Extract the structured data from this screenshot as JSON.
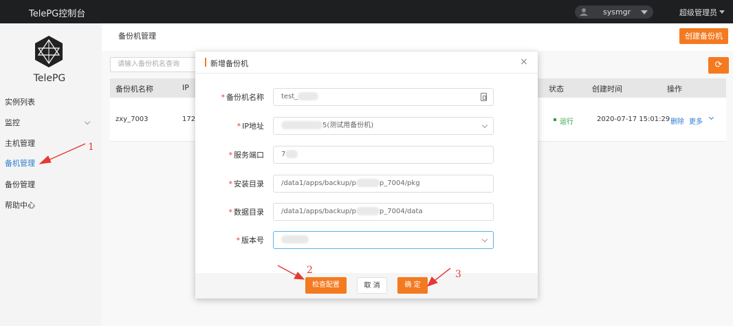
{
  "app": {
    "title": "TelePG控制台",
    "brand": "TelePG"
  },
  "topbar": {
    "username": "sysmgr",
    "role": "超级管理员"
  },
  "sidebar": {
    "items": [
      {
        "label": "实例列表"
      },
      {
        "label": "监控"
      },
      {
        "label": "主机管理"
      },
      {
        "label": "备机管理"
      },
      {
        "label": "备份管理"
      },
      {
        "label": "帮助中心"
      }
    ],
    "active": "备机管理"
  },
  "page": {
    "title": "备份机管理",
    "create_button": "创建备份机",
    "search_placeholder": "请输入备份机名查询",
    "refresh_icon": "refresh-icon"
  },
  "table": {
    "headers": [
      "备份机名称",
      "IP",
      "状态",
      "创建时间",
      "操作"
    ],
    "rows": [
      {
        "name": "zxy_7003",
        "ip": "172.",
        "status": "运行",
        "created": "2020-07-17 15:01:29",
        "delete": "删除",
        "more": "更多"
      }
    ]
  },
  "modal": {
    "title": "新增备份机",
    "fields": [
      {
        "label": "备份机名称",
        "value": "test_"
      },
      {
        "label": "IP地址",
        "value": "5(测试用备份机)"
      },
      {
        "label": "服务端口",
        "value": "7"
      },
      {
        "label": "安装目录",
        "value_prefix": "/data1/apps/backup/p",
        "value_suffix": "p_7004/pkg"
      },
      {
        "label": "数据目录",
        "value_prefix": "/data1/apps/backup/p",
        "value_suffix": "p_7004/data"
      },
      {
        "label": "版本号",
        "value": ""
      }
    ],
    "buttons": {
      "check": "检查配置",
      "cancel": "取 消",
      "confirm": "确 定"
    }
  },
  "annotations": [
    "1",
    "2",
    "3"
  ],
  "colors": {
    "accent": "#f47a20",
    "link": "#2d7dd2",
    "status_ok": "#2ea043",
    "annotation": "#e53935"
  }
}
